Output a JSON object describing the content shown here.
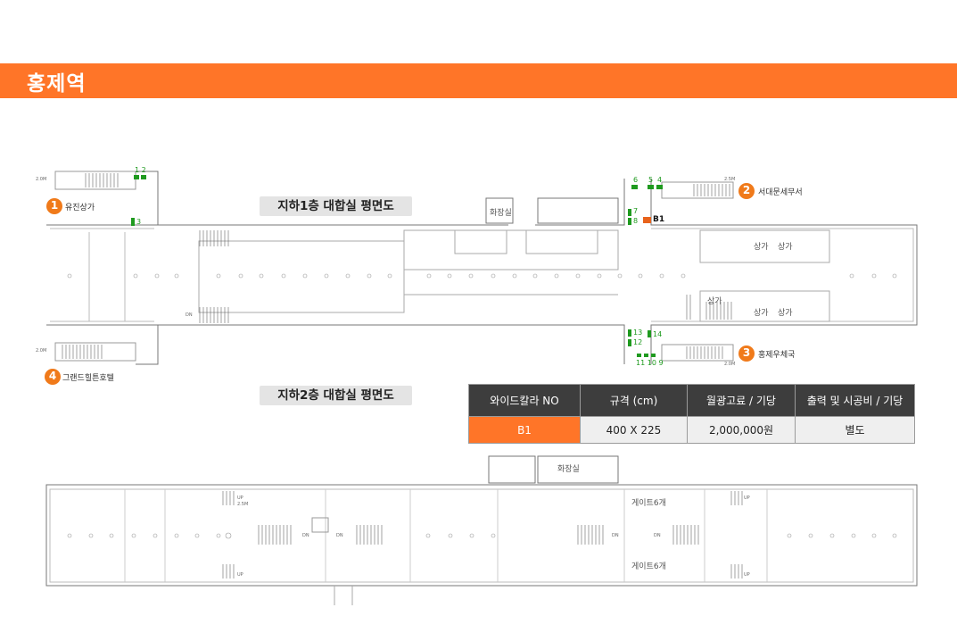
{
  "station": {
    "title": "홍제역"
  },
  "floors": {
    "b1_label": "지하1층 대합실 평면도",
    "b2_label": "지하2층 대합실 평면도"
  },
  "exits": [
    {
      "number": "1",
      "label": "유진상가"
    },
    {
      "number": "2",
      "label": "서대문세무서"
    },
    {
      "number": "3",
      "label": "홍제우체국"
    },
    {
      "number": "4",
      "label": "그랜드힐튼호텔"
    }
  ],
  "b1_labels": {
    "restroom": "화장실",
    "shops": [
      "상가",
      "상가",
      "상가",
      "상가",
      "상가"
    ],
    "marker": "B1",
    "scale_nw": "2.0M",
    "scale_ne": "2.5M",
    "scale_sw": "2.0M",
    "scale_se": "2.0M",
    "dn": "DN",
    "ad_numbers": [
      "1 2",
      "3",
      "6",
      "5",
      "4",
      "7",
      "8",
      "13",
      "12",
      "14",
      "11 10 9"
    ]
  },
  "b2_labels": {
    "restroom": "화장실",
    "gate_top": "게이트6개",
    "gate_bottom": "게이트6개",
    "up": "UP",
    "dn": "DN",
    "scale": "2.5M"
  },
  "colors": {
    "accent": "#ff7528",
    "ad_green": "#1f9a1f",
    "ad_highlight": "#e8631c",
    "table_header": "#3d3d3d"
  },
  "spec_table": {
    "headers": [
      "와이드칼라 NO",
      "규격 (cm)",
      "월광고료 / 기당",
      "출력 및 시공비 / 기당"
    ],
    "rows": [
      {
        "no": "B1",
        "size": "400 X 225",
        "fee": "2,000,000원",
        "install": "별도"
      }
    ]
  }
}
